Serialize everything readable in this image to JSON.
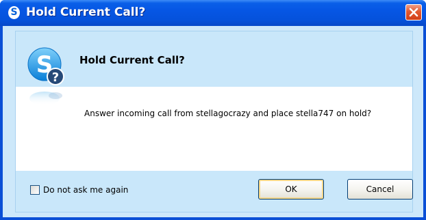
{
  "window": {
    "title": "Hold Current Call?",
    "logo_letter": "S",
    "close_icon": "close-icon"
  },
  "dialog": {
    "heading": "Hold Current Call?",
    "message": "Answer incoming call from stellagocrazy and place stella747 on hold?",
    "icon": "skype-question-icon"
  },
  "footer": {
    "checkbox_label": "Do not ask me again",
    "checkbox_checked": false,
    "ok_label": "OK",
    "cancel_label": "Cancel"
  },
  "colors": {
    "titlebar": "#0656e4",
    "panel": "#c9e7fa",
    "close": "#d23f17"
  }
}
